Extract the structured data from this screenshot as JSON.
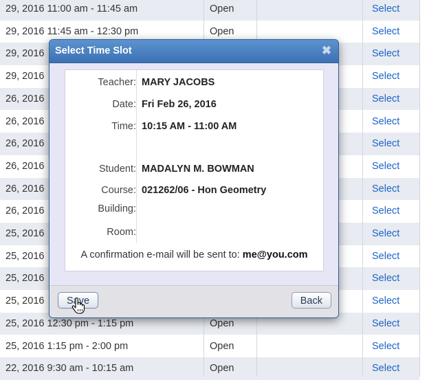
{
  "table": {
    "rows": [
      {
        "when": "29, 2016 11:00 am - 11:45 am",
        "status": "Open",
        "action": "Select"
      },
      {
        "when": "29, 2016 11:45 am - 12:30 pm",
        "status": "Open",
        "action": "Select"
      },
      {
        "when": "29, 2016",
        "status": "",
        "action": "Select"
      },
      {
        "when": "29, 2016",
        "status": "",
        "action": "Select"
      },
      {
        "when": "26, 2016",
        "status": "",
        "action": "Select"
      },
      {
        "when": "26, 2016",
        "status": "",
        "action": "Select"
      },
      {
        "when": "26, 2016",
        "status": "",
        "action": "Select"
      },
      {
        "when": "26, 2016",
        "status": "",
        "action": "Select"
      },
      {
        "when": "26, 2016",
        "status": "",
        "action": "Select"
      },
      {
        "when": "26, 2016",
        "status": "",
        "action": "Select"
      },
      {
        "when": "25, 2016",
        "status": "",
        "action": "Select"
      },
      {
        "when": "25, 2016",
        "status": "",
        "action": "Select"
      },
      {
        "when": "25, 2016",
        "status": "",
        "action": "Select"
      },
      {
        "when": "25, 2016",
        "status": "",
        "action": "Select"
      },
      {
        "when": "25, 2016 12:30 pm - 1:15 pm",
        "status": "Open",
        "action": "Select"
      },
      {
        "when": "25, 2016 1:15 pm - 2:00 pm",
        "status": "Open",
        "action": "Select"
      },
      {
        "when": "22, 2016 9:30 am - 10:15 am",
        "status": "Open",
        "action": "Select"
      }
    ]
  },
  "modal": {
    "title": "Select Time Slot",
    "close_icon": "close-x-icon",
    "labels": {
      "teacher": "Teacher:",
      "date": "Date:",
      "time": "Time:",
      "student": "Student:",
      "course": "Course:",
      "building": "Building:",
      "room": "Room:"
    },
    "values": {
      "teacher": "MARY JACOBS",
      "date": "Fri Feb 26, 2016",
      "time": "10:15 AM - 11:00 AM",
      "student": "MADALYN M. BOWMAN",
      "course": "021262/06 - Hon Geometry",
      "building": "",
      "room": ""
    },
    "confirm_prefix": "A confirmation e-mail will be sent to: ",
    "confirm_email": "me@you.com",
    "save_label": "Save",
    "back_label": "Back"
  },
  "colors": {
    "title_bar": "#3b72b4",
    "link": "#1e64c8",
    "row_alt": "#e8ebf1"
  }
}
